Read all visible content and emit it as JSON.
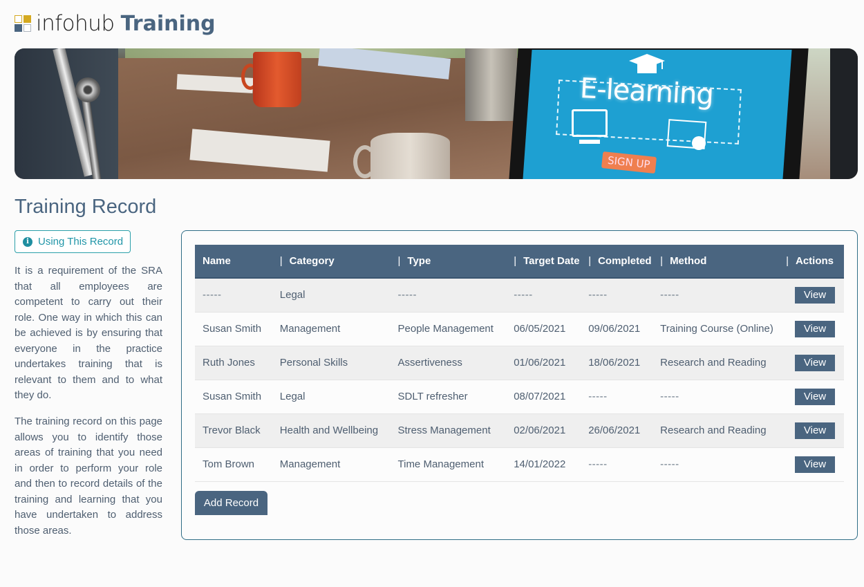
{
  "header": {
    "logo_light": "infohub",
    "logo_bold": "Training"
  },
  "banner": {
    "screen_heading": "E-learning",
    "screen_button": "SIGN UP"
  },
  "page": {
    "title": "Training Record"
  },
  "sidebar": {
    "help_button_label": "Using This Record",
    "help_icon": "info-icon",
    "paragraphs": [
      "It is a requirement of the SRA that all employees are competent to carry out their role. One way in which this can be achieved is by ensuring that everyone in the practice undertakes training that is relevant to them and to what they do.",
      "The training record on this page allows you to identify those areas of training that you need in order to perform your role and then to record details of the training and learning that you have undertaken to address those areas."
    ]
  },
  "table": {
    "columns": [
      "Name",
      "Category",
      "Type",
      "Target Date",
      "Completed",
      "Method",
      "Actions"
    ],
    "separator": "|",
    "rows": [
      {
        "name": "-----",
        "category": "Legal",
        "type": "-----",
        "target_date": "-----",
        "completed": "-----",
        "method": "-----",
        "action": "View"
      },
      {
        "name": "Susan Smith",
        "category": "Management",
        "type": "People Management",
        "target_date": "06/05/2021",
        "completed": "09/06/2021",
        "method": "Training Course (Online)",
        "action": "View"
      },
      {
        "name": "Ruth Jones",
        "category": "Personal Skills",
        "type": "Assertiveness",
        "target_date": "01/06/2021",
        "completed": "18/06/2021",
        "method": "Research and Reading",
        "action": "View"
      },
      {
        "name": "Susan Smith",
        "category": "Legal",
        "type": "SDLT refresher",
        "target_date": "08/07/2021",
        "completed": "-----",
        "method": "-----",
        "action": "View"
      },
      {
        "name": "Trevor Black",
        "category": "Health and Wellbeing",
        "type": "Stress Management",
        "target_date": "02/06/2021",
        "completed": "26/06/2021",
        "method": "Research and Reading",
        "action": "View"
      },
      {
        "name": "Tom Brown",
        "category": "Management",
        "type": "Time Management",
        "target_date": "14/01/2022",
        "completed": "-----",
        "method": "-----",
        "action": "View"
      }
    ],
    "add_button_label": "Add Record"
  },
  "colors": {
    "primary": "#4a6580",
    "accent_teal": "#2196a8",
    "logo_gold": "#d4a920",
    "panel_border": "#2f6d86"
  }
}
